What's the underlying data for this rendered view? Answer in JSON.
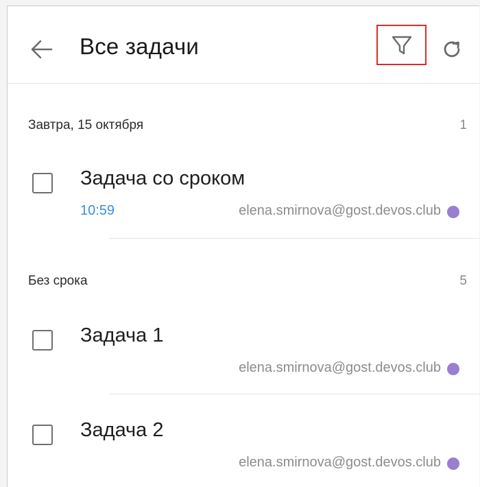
{
  "header": {
    "title": "Все задачи",
    "back_icon": "arrow-left-icon",
    "filter_icon": "filter-funnel-icon",
    "refresh_icon": "refresh-icon",
    "highlight_color": "#d92c2c"
  },
  "sections": [
    {
      "label": "Завтра, 15 октября",
      "count": "1",
      "tasks": [
        {
          "title": "Задача со сроком",
          "time": "10:59",
          "assignee": "elena.smirnova@gost.devos.club"
        }
      ]
    },
    {
      "label": "Без срока",
      "count": "5",
      "tasks": [
        {
          "title": "Задача 1",
          "time": "",
          "assignee": "elena.smirnova@gost.devos.club"
        },
        {
          "title": "Задача 2",
          "time": "",
          "assignee": "elena.smirnova@gost.devos.club"
        }
      ]
    }
  ],
  "colors": {
    "time": "#3f8fd1",
    "status_dot": "#9a7ed1"
  }
}
